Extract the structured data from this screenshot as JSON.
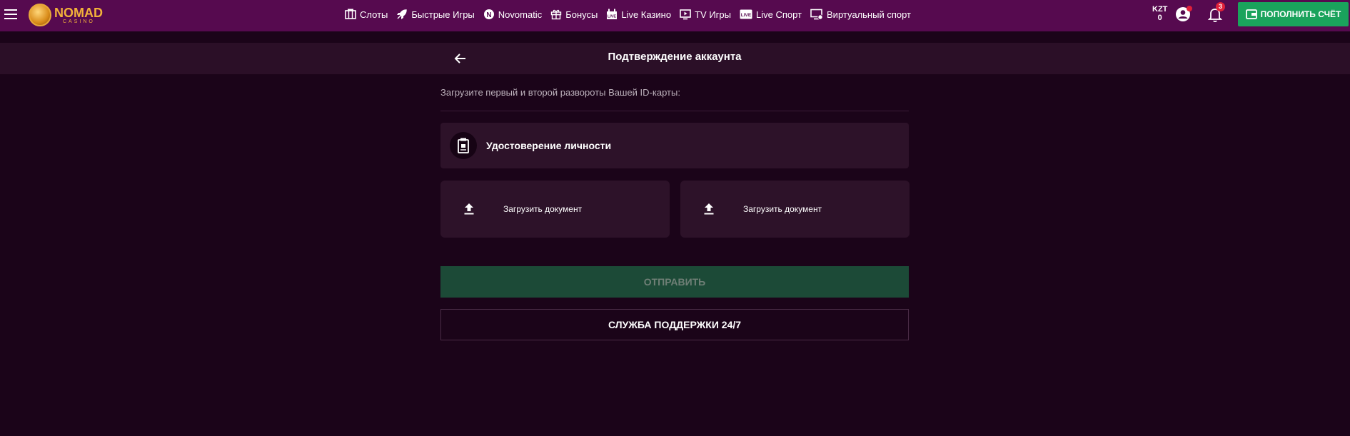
{
  "brand": {
    "name": "NOMAD",
    "sub": "CASINO",
    "accent": "#f2b23a"
  },
  "nav": [
    {
      "label": "Слоты",
      "icon": "slots-icon"
    },
    {
      "label": "Быстрые Игры",
      "icon": "rocket-icon"
    },
    {
      "label": "Novomatic",
      "icon": "novomatic-icon"
    },
    {
      "label": "Бонусы",
      "icon": "gift-icon"
    },
    {
      "label": "Live Казино",
      "icon": "live-casino-icon"
    },
    {
      "label": "TV Игры",
      "icon": "tv-icon"
    },
    {
      "label": "Live Спорт",
      "icon": "live-sport-icon"
    },
    {
      "label": "Виртуальный спорт",
      "icon": "virtual-sport-icon"
    }
  ],
  "account": {
    "currency": "KZT",
    "balance": "0",
    "notifications": "3"
  },
  "deposit_label": "ПОПОЛНИТЬ СЧЁТ",
  "page": {
    "title": "Подтверждение аккаунта",
    "instruction": "Загрузите первый и второй развороты Вашей ID-карты:",
    "document_type": "Удостоверение личности",
    "upload_left": "Загрузить документ",
    "upload_right": "Загрузить документ",
    "submit": "ОТПРАВИТЬ",
    "support": "СЛУЖБА ПОДДЕРЖКИ 24/7"
  },
  "colors": {
    "topbar": "#560a4f",
    "background": "#1b0419",
    "card": "#2d1229",
    "deposit": "#1aa35c",
    "submit": "#1c4a37"
  }
}
